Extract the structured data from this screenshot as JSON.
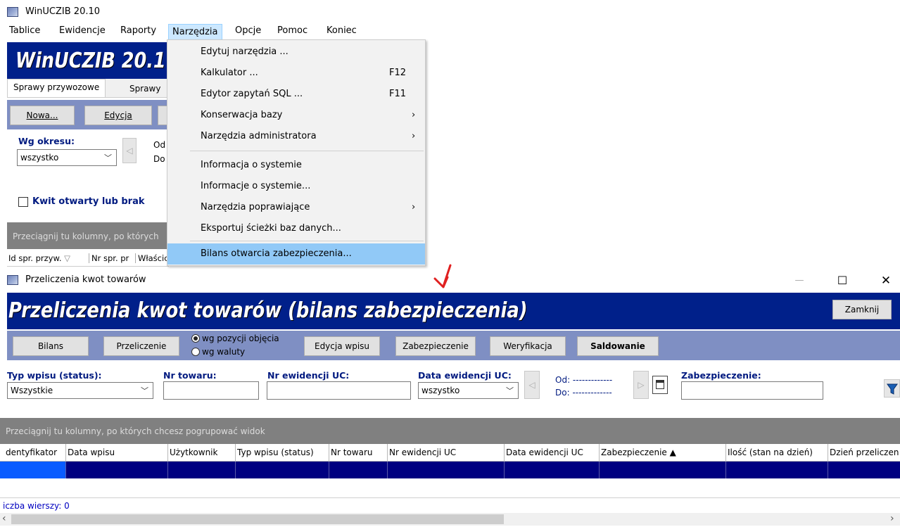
{
  "main_window": {
    "title": "WinUCZIB 20.10",
    "menubar": [
      "Tablice",
      "Ewidencje",
      "Raporty",
      "Narzędzia",
      "Opcje",
      "Pomoc",
      "Koniec"
    ],
    "banner": "WinUCZIB 20.1",
    "tabs": [
      "Sprawy przywozowe",
      "Sprawy"
    ],
    "buttons": {
      "nowa": "Nowa...",
      "edycja": "Edycja"
    },
    "period_label": "Wg okresu:",
    "period_value": "wszystko",
    "od": "Od",
    "do": "Do",
    "checkbox_label": "Kwit otwarty lub brak",
    "group_hint": "Przeciągnij tu kolumny, po których",
    "columns": [
      "Id spr. przyw.",
      "Nr spr. pr",
      "Właścic"
    ]
  },
  "menu": {
    "items": [
      {
        "label": "Edytuj narzędzia ...",
        "shortcut": "",
        "arrow": ""
      },
      {
        "label": "Kalkulator ...",
        "shortcut": "F12",
        "arrow": ""
      },
      {
        "label": "Edytor zapytań SQL ...",
        "shortcut": "F11",
        "arrow": ""
      },
      {
        "label": "Konserwacja bazy",
        "shortcut": "",
        "arrow": "›"
      },
      {
        "label": "Narzędzia administratora",
        "shortcut": "",
        "arrow": "›"
      },
      {
        "label": "Informacja o systemie",
        "shortcut": "",
        "arrow": ""
      },
      {
        "label": "Informacje o systemie...",
        "shortcut": "",
        "arrow": ""
      },
      {
        "label": "Narzędzia poprawiające",
        "shortcut": "",
        "arrow": "›"
      },
      {
        "label": "Eksportuj ścieżki baz danych...",
        "shortcut": "",
        "arrow": ""
      },
      {
        "label": "Bilans otwarcia zabezpieczenia...",
        "shortcut": "",
        "arrow": ""
      }
    ]
  },
  "sub_window": {
    "title": "Przeliczenia kwot towarów",
    "minimize": "—",
    "maximize": "☐",
    "close": "✕",
    "banner": "Przeliczenia kwot towarów (bilans zabezpieczenia)",
    "close_button": "Zamknij",
    "toolbar": {
      "bilans": "Bilans",
      "przeliczenie": "Przeliczenie",
      "radio1": "wg pozycji objęcia",
      "radio2": "wg waluty",
      "edycja_wpisu": "Edycja wpisu",
      "zabezpieczenie": "Zabezpieczenie",
      "weryfikacja": "Weryfikacja",
      "saldowanie": "Saldowanie"
    },
    "filters": {
      "typ_label": "Typ wpisu (status):",
      "typ_value": "Wszystkie",
      "nr_towaru_label": "Nr towaru:",
      "nr_ewid_label": "Nr ewidencji UC:",
      "data_label": "Data ewidencji UC:",
      "data_value": "wszystko",
      "od": "Od: -------------",
      "do": "Do: -------------",
      "zab_label": "Zabezpieczenie:"
    },
    "group_hint": "Przeciągnij tu kolumny, po których chcesz pogrupować widok",
    "columns": [
      "dentyfikator",
      "Data wpisu",
      "Użytkownik",
      "Typ wpisu (status)",
      "Nr towaru",
      "Nr ewidencji UC",
      "Data ewidencji UC",
      "Zabezpieczenie ▲",
      "Ilość (stan na dzień)",
      "Dzień przeliczen"
    ],
    "row_count": "iczba wierszy: 0",
    "scroll_left": "‹",
    "scroll_right": "›"
  },
  "colors": {
    "banner_bg": "#00208a",
    "menu_highlight": "#91c9f7",
    "selected_row": "#000080",
    "arrow": "#e02020"
  }
}
